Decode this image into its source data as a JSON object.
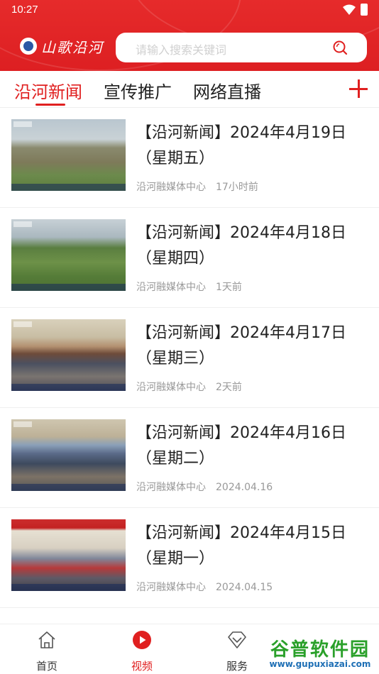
{
  "status": {
    "time": "10:27"
  },
  "header": {
    "logo_text": "山歌沿河",
    "search_placeholder": "请输入搜索关键词"
  },
  "tabs": [
    {
      "label": "沿河新闻",
      "active": true
    },
    {
      "label": "宣传推广",
      "active": false
    },
    {
      "label": "网络直播",
      "active": false
    }
  ],
  "news": [
    {
      "title": "【沿河新闻】2024年4月19日（星期五）",
      "source": "沿河融媒体中心",
      "time": "17小时前"
    },
    {
      "title": "【沿河新闻】2024年4月18日（星期四）",
      "source": "沿河融媒体中心",
      "time": "1天前"
    },
    {
      "title": "【沿河新闻】2024年4月17日（星期三）",
      "source": "沿河融媒体中心",
      "time": "2天前"
    },
    {
      "title": "【沿河新闻】2024年4月16日（星期二）",
      "source": "沿河融媒体中心",
      "time": "2024.04.16"
    },
    {
      "title": "【沿河新闻】2024年4月15日（星期一）",
      "source": "沿河融媒体中心",
      "time": "2024.04.15"
    }
  ],
  "bottom_nav": [
    {
      "label": "首页",
      "icon": "home-icon",
      "active": false
    },
    {
      "label": "视频",
      "icon": "play-icon",
      "active": true
    },
    {
      "label": "服务",
      "icon": "diamond-icon",
      "active": false
    }
  ],
  "watermark": {
    "title": "谷普软件园",
    "url": "www.gupuxiazai.com"
  },
  "colors": {
    "brand": "#e02020",
    "header": "#e62b2b",
    "meta": "#999999"
  }
}
